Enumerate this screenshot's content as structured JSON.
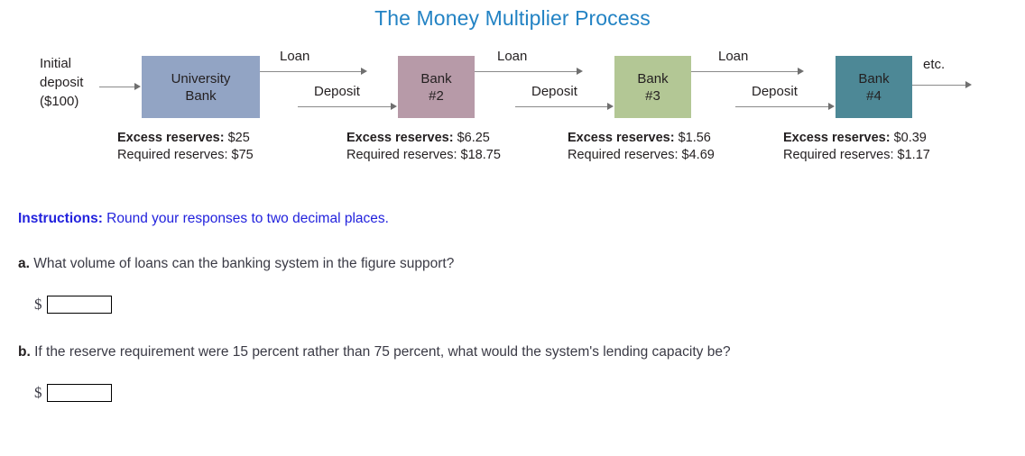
{
  "figure": {
    "title": "The Money Multiplier Process",
    "initial_label_lines": [
      "Initial",
      "deposit",
      "($100)"
    ],
    "initial_arrow_label": "",
    "etc_label": "etc.",
    "loan_label": "Loan",
    "deposit_label": "Deposit",
    "excess_label": "Excess reserves:",
    "required_label": "Required reserves:",
    "banks": [
      {
        "name_line1": "University",
        "name_line2": "Bank",
        "color": "#92a4c4",
        "excess": "$25",
        "required": "$75"
      },
      {
        "name_line1": "Bank",
        "name_line2": "#2",
        "color": "#b79aa8",
        "excess": "$6.25",
        "required": "$18.75"
      },
      {
        "name_line1": "Bank",
        "name_line2": "#3",
        "color": "#b3c795",
        "excess": "$1.56",
        "required": "$4.69"
      },
      {
        "name_line1": "Bank",
        "name_line2": "#4",
        "color": "#4d8896",
        "excess": "$0.39",
        "required": "$1.17"
      }
    ]
  },
  "question": {
    "instructions_bold": "Instructions:",
    "instructions_text": " Round your responses to two decimal places.",
    "parts": [
      {
        "letter": "a.",
        "text": " What volume of loans can the banking system in the figure support?",
        "currency_symbol": "$",
        "answer_value": "",
        "answer_placeholder": ""
      },
      {
        "letter": "b.",
        "text": " If the reserve requirement were 15 percent rather than 75 percent, what would the system's lending capacity be?",
        "currency_symbol": "$",
        "answer_value": "",
        "answer_placeholder": ""
      }
    ]
  },
  "colors": {
    "title_blue": "#2383c4",
    "instructions_blue": "#2222dd",
    "body_text": "#3a3a45",
    "arrow_gray": "#8a8a8a"
  }
}
